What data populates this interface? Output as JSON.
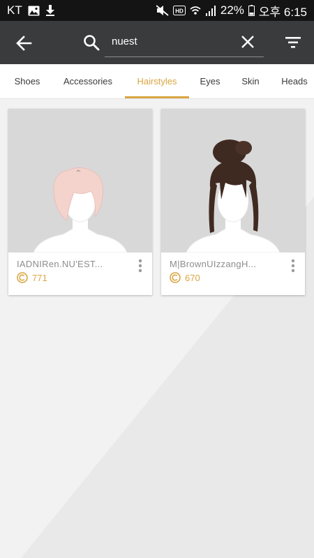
{
  "status_bar": {
    "carrier": "KT",
    "battery": "22%",
    "time": "오후 6:15",
    "icons": [
      "image-icon",
      "download-icon",
      "mute-icon",
      "hd-icon",
      "wifi-icon",
      "signal-icon",
      "battery-icon"
    ]
  },
  "header": {
    "search_value": "nuest",
    "icons": [
      "back-arrow-icon",
      "search-icon",
      "close-icon",
      "filter-icon"
    ]
  },
  "tabs": [
    {
      "label": "Shoes",
      "active": false
    },
    {
      "label": "Accessories",
      "active": false
    },
    {
      "label": "Hairstyles",
      "active": true
    },
    {
      "label": "Eyes",
      "active": false
    },
    {
      "label": "Skin",
      "active": false
    },
    {
      "label": "Heads",
      "active": false
    }
  ],
  "items": [
    {
      "name": "IADNIRen.NU'EST...",
      "price": "771",
      "hair_color": "#f3d3cc"
    },
    {
      "name": "M|BrownUIzzangH...",
      "price": "670",
      "hair_color": "#3f2a22"
    }
  ],
  "colors": {
    "accent": "#d9a642",
    "app_bar": "#393b3d",
    "status_bar": "#141414",
    "card_thumb": "#d8d8d8"
  }
}
